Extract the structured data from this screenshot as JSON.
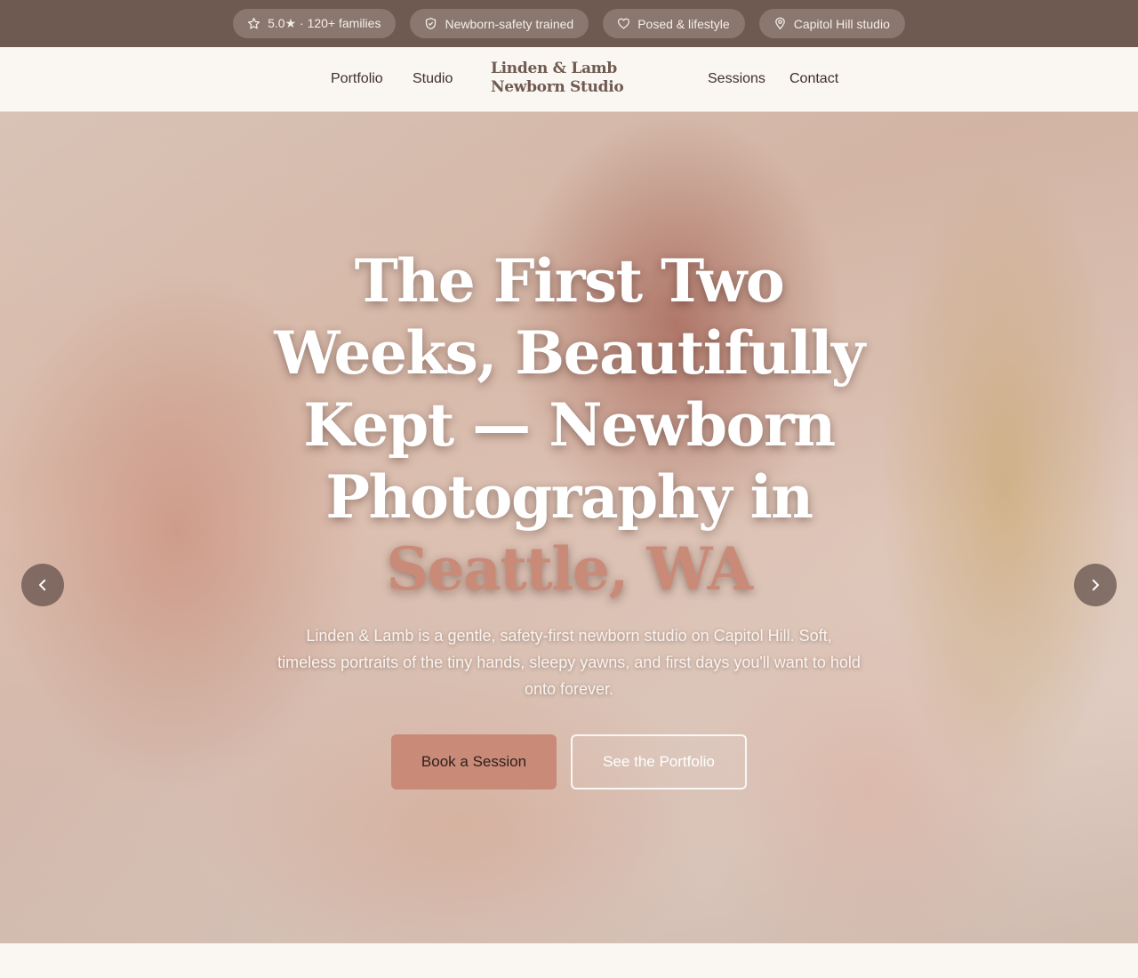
{
  "topbar": {
    "badges": [
      {
        "icon": "star-icon",
        "label": "5.0★ · 120+ families"
      },
      {
        "icon": "shield-icon",
        "label": "Newborn-safety trained"
      },
      {
        "icon": "heart-icon",
        "label": "Posed & lifestyle"
      },
      {
        "icon": "map-pin-icon",
        "label": "Capitol Hill studio"
      }
    ]
  },
  "nav": {
    "links_left": [
      "Portfolio",
      "Studio"
    ],
    "brand_line1": "Linden & Lamb",
    "brand_line2": "Newborn Studio",
    "links_right": [
      "Sessions",
      "Contact"
    ]
  },
  "hero": {
    "headline_line1": "The First Two",
    "headline_line2": "Weeks, Beautifully",
    "headline_line3": "Kept — Newborn",
    "headline_line4": "Photography in",
    "headline_accent": "Seattle, WA",
    "subtext": "Linden & Lamb is a gentle, safety-first newborn studio on Capitol Hill. Soft, timeless portraits of the tiny hands, sleepy yawns, and first days you'll want to hold onto forever.",
    "primary_cta": "Book a Session",
    "secondary_cta": "See the Portfolio",
    "prev_icon": "chevron-left-icon",
    "next_icon": "chevron-right-icon"
  },
  "colors": {
    "topbar": "#6e5a51",
    "accent": "#c98a78",
    "background": "#faf6f1"
  }
}
